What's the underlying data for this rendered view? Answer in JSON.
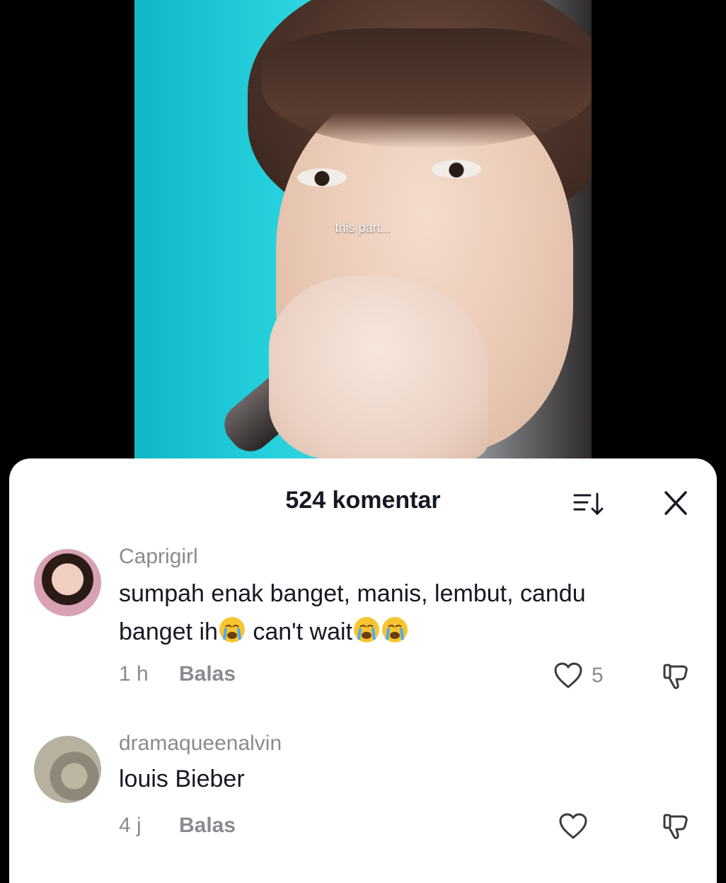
{
  "video": {
    "caption": "this part..."
  },
  "sheet": {
    "title": "524 komentar"
  },
  "comments": [
    {
      "username": "Caprigirl",
      "text_line1": "sumpah enak banget, manis, lembut, candu",
      "text_line2_a": "banget ih",
      "text_line2_b": " can't wait",
      "time": "1 h",
      "reply": "Balas",
      "likes": "5"
    },
    {
      "username": "dramaqueenalvin",
      "text": "louis Bieber",
      "time": "4 j",
      "reply": "Balas"
    }
  ]
}
